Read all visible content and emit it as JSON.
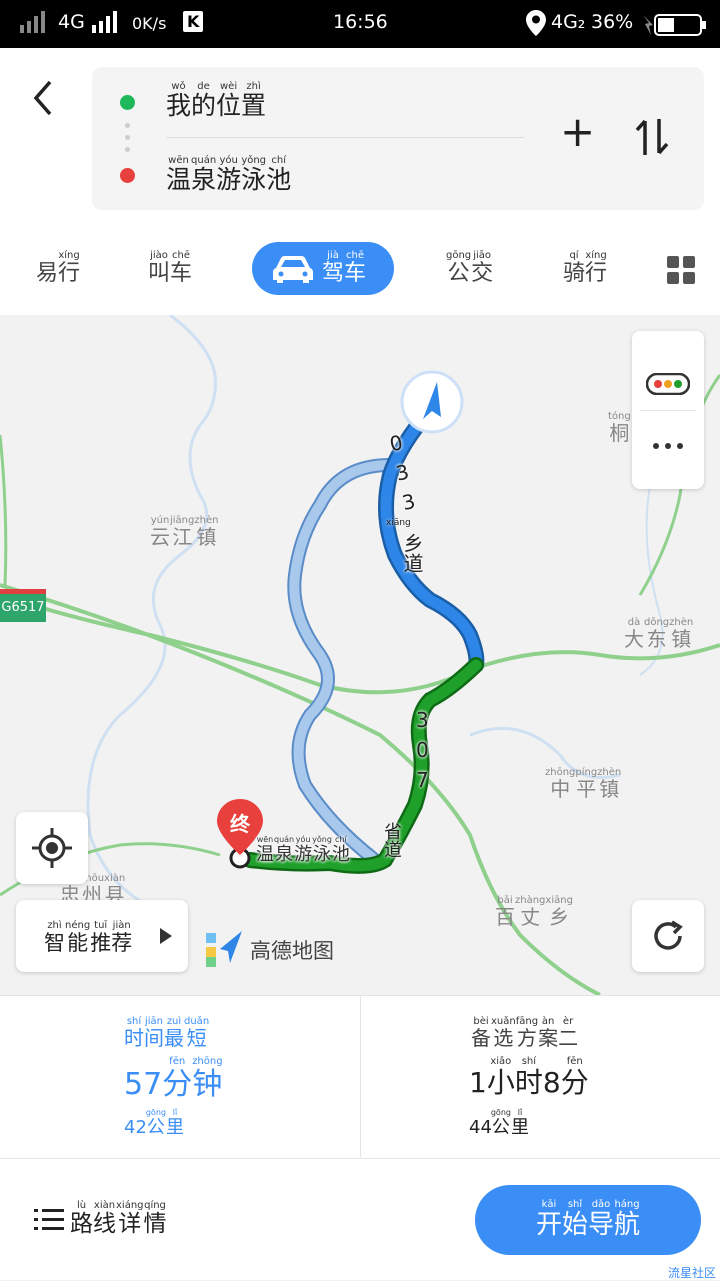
{
  "status_bar": {
    "network": "4G",
    "speed": "0K/s",
    "app_badge": "K",
    "time": "16:56",
    "network2": "4G₂",
    "battery": "36%"
  },
  "route": {
    "from": {
      "pinyin": [
        "wǒ",
        "de",
        "wèi",
        "zhì"
      ],
      "chars": [
        "我",
        "的",
        "位",
        "置"
      ]
    },
    "to": {
      "pinyin": [
        "wēn",
        "quán",
        "yóu",
        "yǒng",
        "chí"
      ],
      "chars": [
        "温",
        "泉",
        "游",
        "泳",
        "池"
      ]
    },
    "add_symbol": "+",
    "swap_symbol": "⇅"
  },
  "tabs": [
    {
      "pinyin": [
        "",
        "xíng"
      ],
      "chars": [
        "易",
        "行"
      ]
    },
    {
      "pinyin": [
        "jiào",
        "chē"
      ],
      "chars": [
        "叫",
        "车"
      ]
    },
    {
      "pinyin": [
        "jià",
        "chē"
      ],
      "chars": [
        "驾",
        "车"
      ]
    },
    {
      "pinyin": [
        "gōng",
        "jiāo"
      ],
      "chars": [
        "公",
        "交"
      ]
    },
    {
      "pinyin": [
        "qí",
        "xíng"
      ],
      "chars": [
        "骑",
        "行"
      ]
    }
  ],
  "map": {
    "labels": {
      "yunjiang": {
        "pinyin": [
          "yún",
          "jiāng",
          "zhèn"
        ],
        "chars": [
          "云",
          "江",
          "镇"
        ]
      },
      "tong": {
        "pinyin": [
          "tóng"
        ],
        "chars": [
          "桐"
        ]
      },
      "dadong": {
        "pinyin": [
          "dà",
          "dōng",
          "zhèn"
        ],
        "chars": [
          "大",
          "东",
          "镇"
        ]
      },
      "zhongping": {
        "pinyin": [
          "zhōng",
          "píng",
          "zhèn"
        ],
        "chars": [
          "中",
          "平",
          "镇"
        ]
      },
      "zhouxian": {
        "pinyin": [
          "",
          "zhōu",
          "xiàn"
        ],
        "chars": [
          "忠",
          "州",
          "县"
        ]
      },
      "baizhang": {
        "pinyin": [
          "bǎi",
          "zhàng",
          "xiāng"
        ],
        "chars": [
          "百",
          "丈",
          "乡"
        ]
      },
      "highway": "G6517",
      "dest_road_label": {
        "pinyin": [
          "wēn",
          "quán",
          "yóu",
          "yǒng",
          "chí"
        ],
        "chars": [
          "温",
          "泉",
          "游",
          "泳",
          "池"
        ]
      },
      "dest_marker": "终",
      "road_number_1": "033",
      "road_1_suffix": {
        "pinyin": [
          "xiāng",
          "dào"
        ],
        "chars": [
          "乡",
          "道"
        ]
      },
      "road_number_2": "307",
      "road_2_suffix": {
        "pinyin": [
          "shěng",
          "dào"
        ],
        "chars": [
          "省",
          "道"
        ]
      }
    },
    "smart_recommend": {
      "pinyin": [
        "zhì",
        "néng",
        "tuī",
        "jiàn"
      ],
      "chars": [
        "智",
        "能",
        "推",
        "荐"
      ]
    },
    "brand": "高德地图"
  },
  "plans": [
    {
      "title": {
        "pinyin": [
          "shí",
          "jiān",
          "zuì",
          "duǎn"
        ],
        "chars": [
          "时",
          "间",
          "最",
          "短"
        ]
      },
      "duration_num": "57",
      "duration_unit": {
        "pinyin": [
          "fēn",
          "zhōng"
        ],
        "chars": [
          "分",
          "钟"
        ]
      },
      "distance_num": "42",
      "distance_unit": {
        "pinyin": [
          "gōng",
          "lǐ"
        ],
        "chars": [
          "公",
          "里"
        ]
      }
    },
    {
      "title": {
        "pinyin": [
          "bèi",
          "xuǎn",
          "fāng",
          "àn",
          "èr"
        ],
        "chars": [
          "备",
          "选",
          "方",
          "案",
          "二"
        ]
      },
      "duration_num1": "1",
      "duration_unit1": {
        "pinyin": [
          "xiǎo",
          "shí"
        ],
        "chars": [
          "小",
          "时"
        ]
      },
      "duration_num2": "8",
      "duration_unit2": {
        "pinyin": [
          "fēn"
        ],
        "chars": [
          "分"
        ]
      },
      "distance_num": "44",
      "distance_unit": {
        "pinyin": [
          "gōng",
          "lǐ"
        ],
        "chars": [
          "公",
          "里"
        ]
      }
    }
  ],
  "footer": {
    "route_details": {
      "pinyin": [
        "lù",
        "xiàn",
        "xiáng",
        "qíng"
      ],
      "chars": [
        "路",
        "线",
        "详",
        "情"
      ]
    },
    "start_nav": {
      "pinyin": [
        "kāi",
        "shǐ",
        "dǎo",
        "háng"
      ],
      "chars": [
        "开",
        "始",
        "导",
        "航"
      ]
    },
    "watermark": "流星社区"
  },
  "colors": {
    "accent": "#3a8ef6",
    "route_blue": "#2e86e8",
    "route_green": "#1fa02a",
    "alt_route": "#a8c8ec",
    "marker_red": "#e8403c"
  }
}
